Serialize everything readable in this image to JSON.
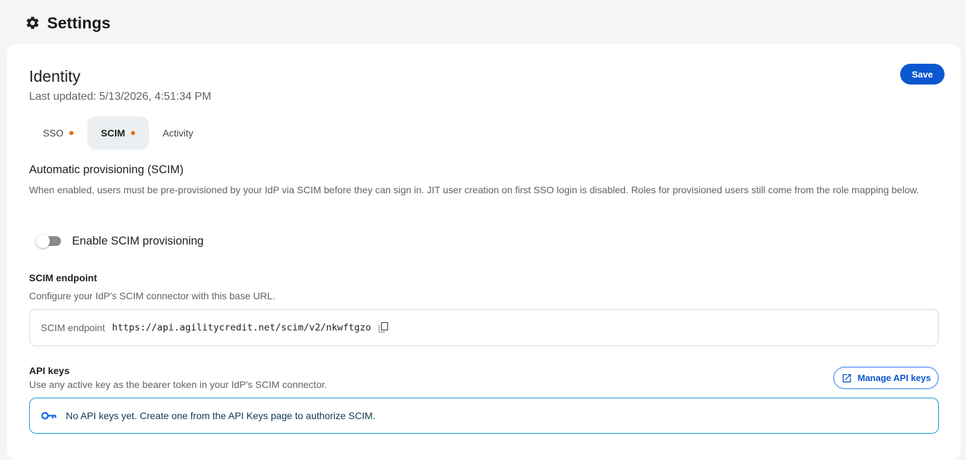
{
  "page": {
    "title": "Settings",
    "icon": "gear-icon"
  },
  "section": {
    "title": "Identity",
    "last_updated_label": "Last updated:",
    "last_updated_value": "5/13/2026, 4:51:34 PM",
    "save_label": "Save"
  },
  "tabs": [
    {
      "label": "SSO",
      "has_dot": true,
      "active": false
    },
    {
      "label": "SCIM",
      "has_dot": true,
      "active": true
    },
    {
      "label": "Activity",
      "has_dot": false,
      "active": false
    }
  ],
  "provisioning": {
    "title": "Automatic provisioning (SCIM)",
    "description": "When enabled, users must be pre-provisioned by your IdP via SCIM before they can sign in. JIT user creation on first SSO login is disabled. Roles for provisioned users still come from the role mapping below.",
    "toggle_label": "Enable SCIM provisioning",
    "toggle_enabled": false
  },
  "endpoint": {
    "title": "SCIM endpoint",
    "description": "Configure your IdP's SCIM connector with this base URL.",
    "label": "SCIM endpoint",
    "url": "https://api.agilitycredit.net/scim/v2/nkwftgzo",
    "copy_icon": "copy-icon"
  },
  "api_keys": {
    "title": "API keys",
    "description": "Use any active key as the bearer token in your IdP's SCIM connector.",
    "manage_label": "Manage API keys",
    "manage_icon": "external-link-icon",
    "empty_message": "No API keys yet. Create one from the API Keys page to authorize SCIM.",
    "empty_icon": "key-icon"
  },
  "colors": {
    "primary": "#0b57d0",
    "tab_dot": "#e8710a",
    "info_border": "#1a9bd7",
    "key_icon": "#1a73e8"
  }
}
